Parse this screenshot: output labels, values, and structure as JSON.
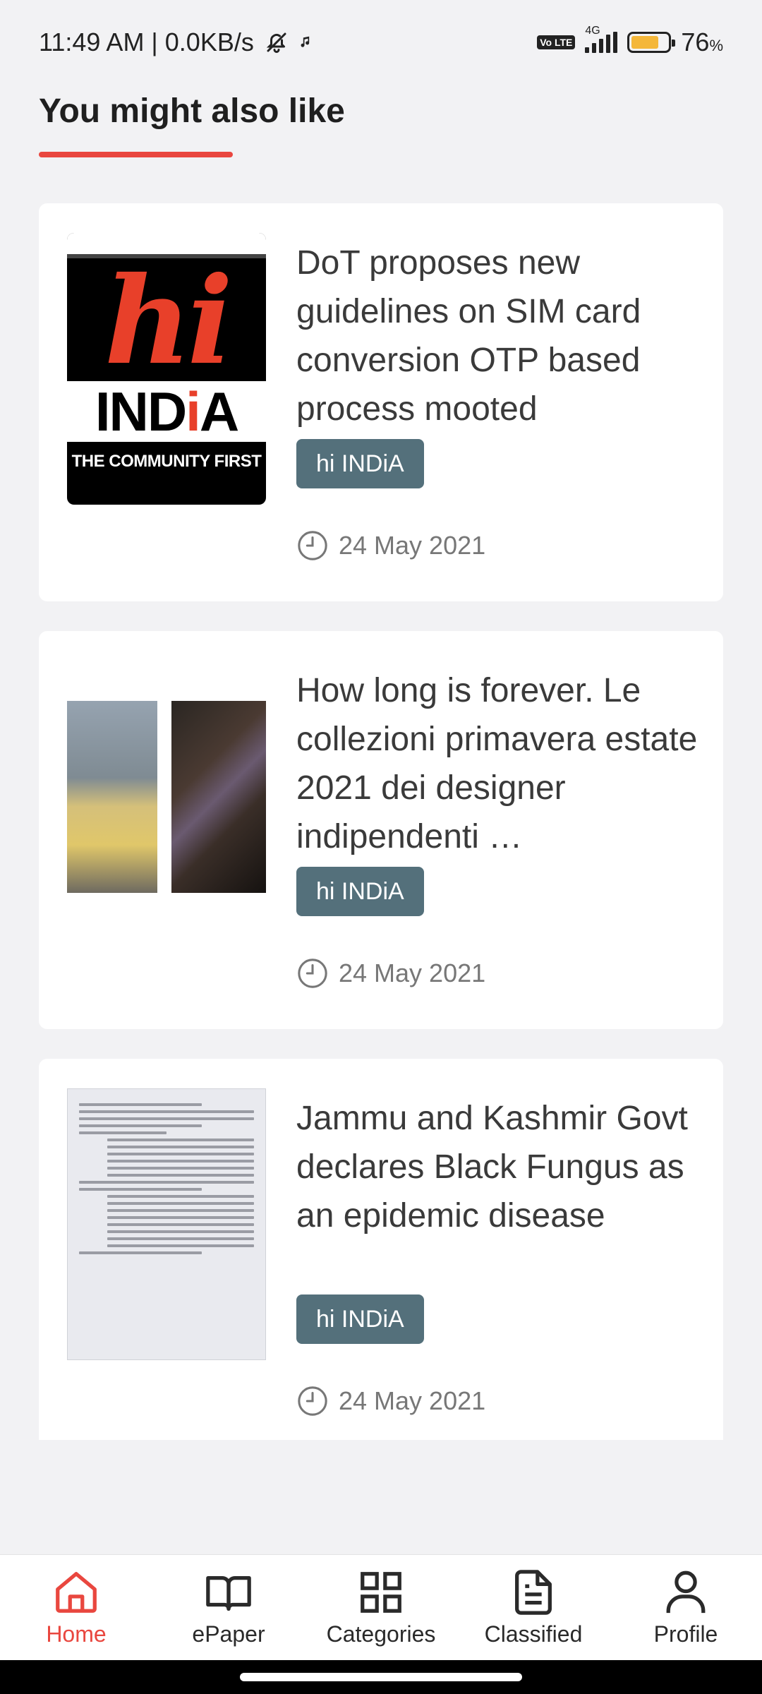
{
  "status_bar": {
    "time": "11:49 AM | 0.0KB/s",
    "volte": "Vo LTE",
    "network": "4G",
    "battery_percent": "76",
    "battery_suffix": "%",
    "battery_level": 0.76,
    "battery_color": "#f4b73a"
  },
  "section": {
    "title": "You might also like",
    "accent_color": "#e9473f"
  },
  "articles": [
    {
      "title": "DoT proposes new guidelines on SIM card conversion OTP based process mooted",
      "source": "hi INDiA",
      "date": "24 May 2021",
      "thumbnail": {
        "kind": "logo",
        "logo_word": "hi",
        "logo_brand_a": "IND",
        "logo_brand_b": "i",
        "logo_brand_c": "A",
        "logo_tagline": "THE COMMUNITY FIRST"
      }
    },
    {
      "title": "How long is forever. Le collezioni primavera estate 2021 dei designer indipendenti …",
      "source": "hi INDiA",
      "date": "24 May 2021",
      "thumbnail": {
        "kind": "photo-collage"
      }
    },
    {
      "title": "Jammu and Kashmir Govt declares Black Fungus as an epidemic disease",
      "source": "hi INDiA",
      "date": "24 May 2021",
      "thumbnail": {
        "kind": "document-scan"
      }
    }
  ],
  "bottom_nav": {
    "items": [
      {
        "label": "Home",
        "icon": "home-icon",
        "active": true
      },
      {
        "label": "ePaper",
        "icon": "book-icon",
        "active": false
      },
      {
        "label": "Categories",
        "icon": "grid-icon",
        "active": false
      },
      {
        "label": "Classified",
        "icon": "document-icon",
        "active": false
      },
      {
        "label": "Profile",
        "icon": "person-icon",
        "active": false
      }
    ],
    "active_color": "#e9473f"
  }
}
